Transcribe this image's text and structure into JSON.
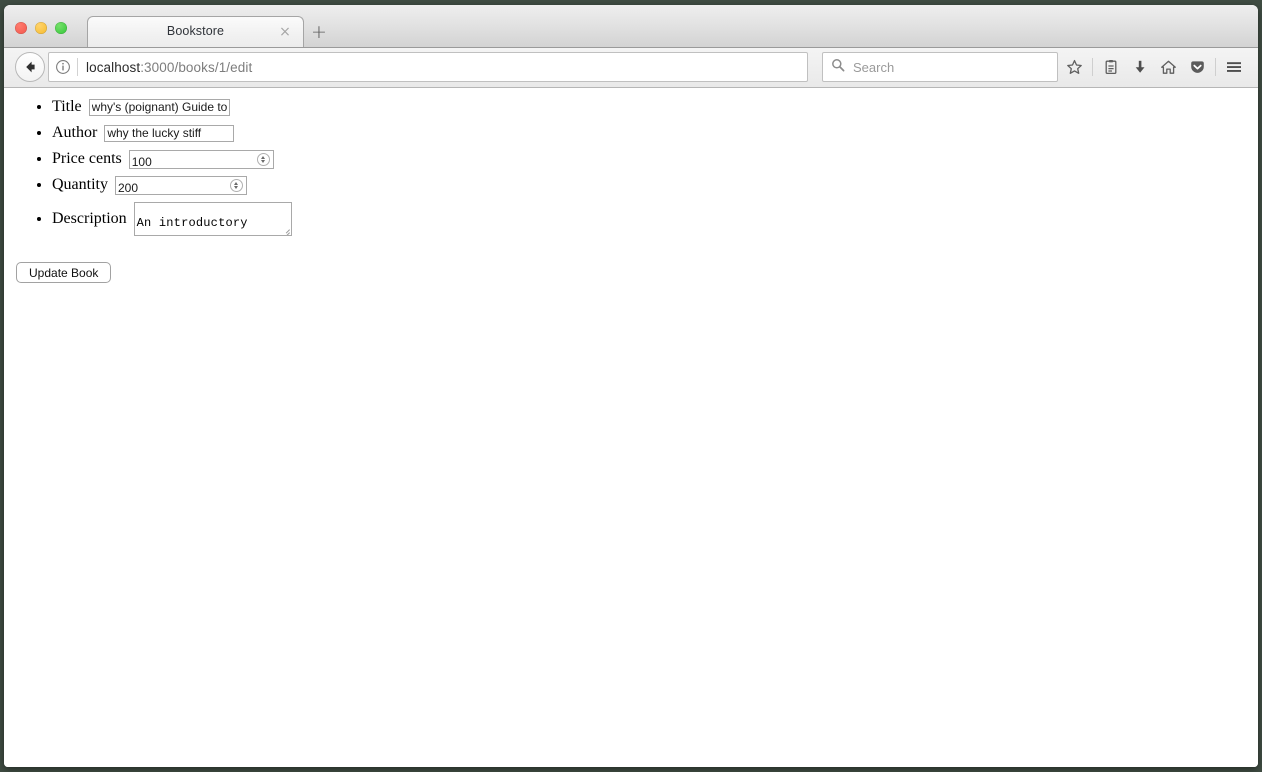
{
  "window": {
    "traffic_lights": [
      "close",
      "minimize",
      "maximize"
    ]
  },
  "tab_bar": {
    "tab_title": "Bookstore",
    "close_glyph": "×",
    "new_tab_glyph": "+"
  },
  "toolbar": {
    "back_icon": "back-arrow-icon",
    "identity_icon": "info-icon",
    "url": {
      "host": "localhost",
      "path": ":3000/books/1/edit",
      "full": "localhost:3000/books/1/edit"
    },
    "reload_icon": "reload-icon",
    "search": {
      "placeholder": "Search",
      "value": "",
      "icon": "search-icon"
    },
    "icons": [
      {
        "name": "bookmark-star-icon",
        "label": "Bookmark this page"
      },
      {
        "name": "library-icon",
        "label": "Show your library"
      },
      {
        "name": "downloads-icon",
        "label": "Downloads"
      },
      {
        "name": "home-icon",
        "label": "Home"
      },
      {
        "name": "pocket-icon",
        "label": "Save to Pocket"
      },
      {
        "name": "menu-hamburger-icon",
        "label": "Open menu"
      }
    ]
  },
  "page": {
    "form": {
      "fields": [
        {
          "label": "Title",
          "value": "why's (poignant) Guide to",
          "type": "text"
        },
        {
          "label": "Author",
          "value": "why the lucky stiff",
          "type": "text"
        },
        {
          "label": "Price cents",
          "value": "100",
          "type": "number"
        },
        {
          "label": "Quantity",
          "value": "200",
          "type": "number"
        },
        {
          "label": "Description",
          "value": "An introductory\nbook to the Ruby",
          "type": "textarea"
        }
      ],
      "submit_label": "Update Book"
    }
  },
  "colors": {
    "desktop_backdrop": "#3f4c42",
    "toolbar_bg": "#ececec",
    "page_bg": "#ffffff",
    "url_host_text": "#2b2b2b",
    "url_path_text": "#7d7d7d"
  }
}
